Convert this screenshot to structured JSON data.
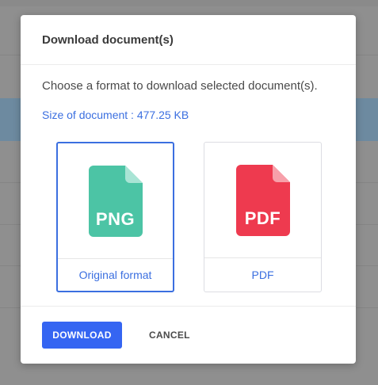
{
  "modal": {
    "title": "Download document(s)",
    "description": "Choose a format to download selected document(s).",
    "size_text": "Size of document : 477.25 KB"
  },
  "options": [
    {
      "icon": "png-file-icon",
      "icon_text": "PNG",
      "label": "Original format",
      "selected": true,
      "color": "#4cc4a5"
    },
    {
      "icon": "pdf-file-icon",
      "icon_text": "PDF",
      "label": "PDF",
      "selected": false,
      "color": "#ee3a4f"
    }
  ],
  "footer": {
    "download_label": "DOWNLOAD",
    "cancel_label": "CANCEL"
  },
  "colors": {
    "accent": "#3565f2",
    "link": "#3b6fe0"
  }
}
